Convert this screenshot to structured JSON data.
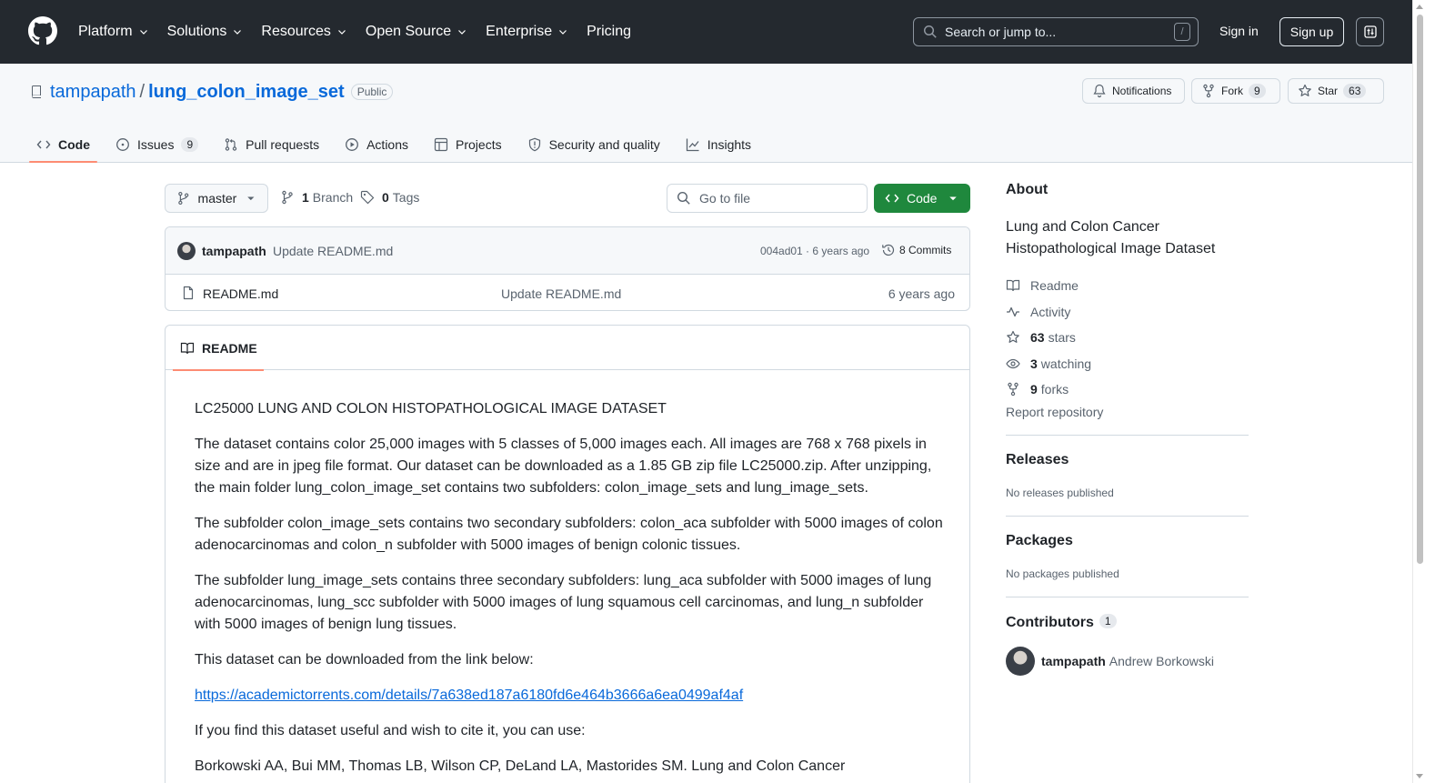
{
  "header": {
    "nav": [
      "Platform",
      "Solutions",
      "Resources",
      "Open Source",
      "Enterprise",
      "Pricing"
    ],
    "search_placeholder": "Search or jump to...",
    "search_shortcut": "/",
    "sign_in": "Sign in",
    "sign_up": "Sign up"
  },
  "repo": {
    "owner": "tampapath",
    "separator": "/",
    "name": "lung_colon_image_set",
    "visibility": "Public",
    "notifications_label": "Notifications",
    "fork_label": "Fork",
    "fork_count": "9",
    "star_label": "Star",
    "star_count": "63"
  },
  "tabs": [
    {
      "label": "Code",
      "icon": "code-icon"
    },
    {
      "label": "Issues",
      "icon": "issue-icon",
      "count": "9"
    },
    {
      "label": "Pull requests",
      "icon": "pull-request-icon"
    },
    {
      "label": "Actions",
      "icon": "play-icon"
    },
    {
      "label": "Projects",
      "icon": "table-icon"
    },
    {
      "label": "Security and quality",
      "icon": "shield-icon"
    },
    {
      "label": "Insights",
      "icon": "graph-icon"
    }
  ],
  "filebar": {
    "branch": "master",
    "branch_count": "1",
    "branch_label": "Branch",
    "tag_count": "0",
    "tag_label": "Tags",
    "goto_placeholder": "Go to file",
    "code_label": "Code"
  },
  "commit": {
    "user": "tampapath",
    "message": "Update README.md",
    "hash_age": "004ad01 · 6 years ago",
    "commits_label": "8 Commits"
  },
  "files": [
    {
      "name": "README.md",
      "message": "Update README.md",
      "age": "6 years ago"
    }
  ],
  "readme": {
    "tab_label": "README",
    "title": "LC25000 LUNG AND COLON HISTOPATHOLOGICAL IMAGE DATASET",
    "p1": "The dataset contains color 25,000 images with 5 classes of 5,000 images each. All images are 768 x 768 pixels in size and are in jpeg file format. Our dataset can be downloaded as a 1.85 GB zip file LC25000.zip. After unzipping, the main folder lung_colon_image_set contains two subfolders: colon_image_sets and lung_image_sets.",
    "p2": "The subfolder colon_image_sets contains two secondary subfolders: colon_aca subfolder with 5000 images of colon adenocarcinomas and colon_n subfolder with 5000 images of benign colonic tissues.",
    "p3": "The subfolder lung_image_sets contains three secondary subfolders: lung_aca subfolder with 5000 images of lung adenocarcinomas, lung_scc subfolder with 5000 images of lung squamous cell carcinomas, and lung_n subfolder with 5000 images of benign lung tissues.",
    "p4": "This dataset can be downloaded from the link below:",
    "link": "https://academictorrents.com/details/7a638ed187a6180fd6e464b3666a6ea0499af4af",
    "p5": "If you find this dataset useful and wish to cite it, you can use:",
    "p6": "Borkowski AA, Bui MM, Thomas LB, Wilson CP, DeLand LA, Mastorides SM. Lung and Colon Cancer"
  },
  "about": {
    "heading": "About",
    "description": "Lung and Colon Cancer Histopathological Image Dataset",
    "readme": "Readme",
    "activity": "Activity",
    "stars_count": "63",
    "stars_label": "stars",
    "watching_count": "3",
    "watching_label": "watching",
    "forks_count": "9",
    "forks_label": "forks",
    "report": "Report repository"
  },
  "releases": {
    "heading": "Releases",
    "note": "No releases published"
  },
  "packages": {
    "heading": "Packages",
    "note": "No packages published"
  },
  "contributors": {
    "heading": "Contributors",
    "count": "1",
    "user": "tampapath",
    "full_name": "Andrew Borkowski"
  },
  "colors": {
    "header_bg": "#24292f",
    "link": "#0969da",
    "primary_button": "#1f883d",
    "tab_underline": "#fd8c73"
  }
}
